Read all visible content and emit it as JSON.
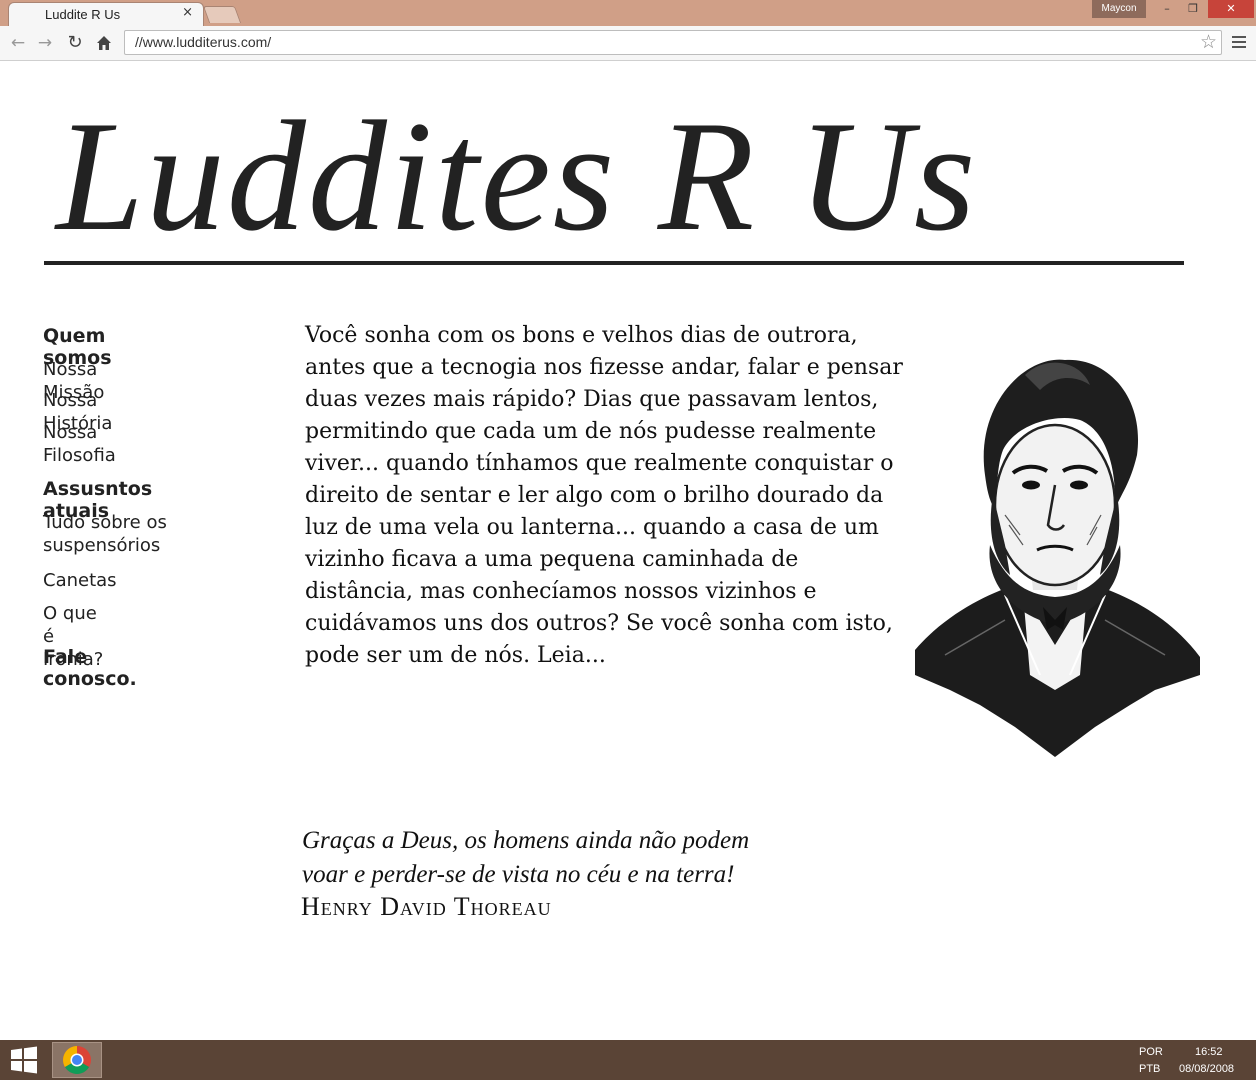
{
  "browser": {
    "tab_title": "Luddite R Us",
    "tab_close": "×",
    "user": "Maycon",
    "url": "//www.ludditerus.com/",
    "window_controls": {
      "minimize": "–",
      "maximize": "❐",
      "close": "✕"
    },
    "icons": {
      "back": "back-arrow-icon",
      "forward": "forward-arrow-icon",
      "reload": "reload-icon",
      "home": "home-icon",
      "bookmark": "star-icon",
      "menu": "menu-icon"
    }
  },
  "site": {
    "logo": "Luddites R Us"
  },
  "sidebar": {
    "section1_title": "Quem somos",
    "section1_items": [
      "Nossa Missão",
      "Nossa História",
      "Nossa Filosofia"
    ],
    "section2_title": "Assusntos atuais",
    "section2_items": [
      "Tudo sobre os suspensórios",
      "Canetas",
      "O que é Ironia?"
    ],
    "contact": "Fale conosco."
  },
  "main": {
    "intro": "Você sonha com os bons e velhos dias de outrora, antes que a tecnogia nos fizesse andar, falar e pensar duas vezes mais rápido? Dias que passavam lentos, permitindo que cada um de nós pudesse realmente viver... quando tínhamos que realmente conquistar o direito de sentar e ler algo com o brilho dourado da luz de uma vela ou lanterna... quando a casa de um vizinho ficava a uma pequena caminhada de distância, mas conhecíamos nossos vizinhos e cuidávamos uns dos outros? Se você sonha com isto, pode ser um de nós. Leia...",
    "quote_line1": "Graças a Deus, os homens ainda não podem",
    "quote_line2": "voar e perder-se de vista no céu e na terra!",
    "quote_author": "Henry David Thoreau"
  },
  "taskbar": {
    "lang1": "POR",
    "lang2": "PTB",
    "time": "16:52",
    "date": "08/08/2008"
  }
}
